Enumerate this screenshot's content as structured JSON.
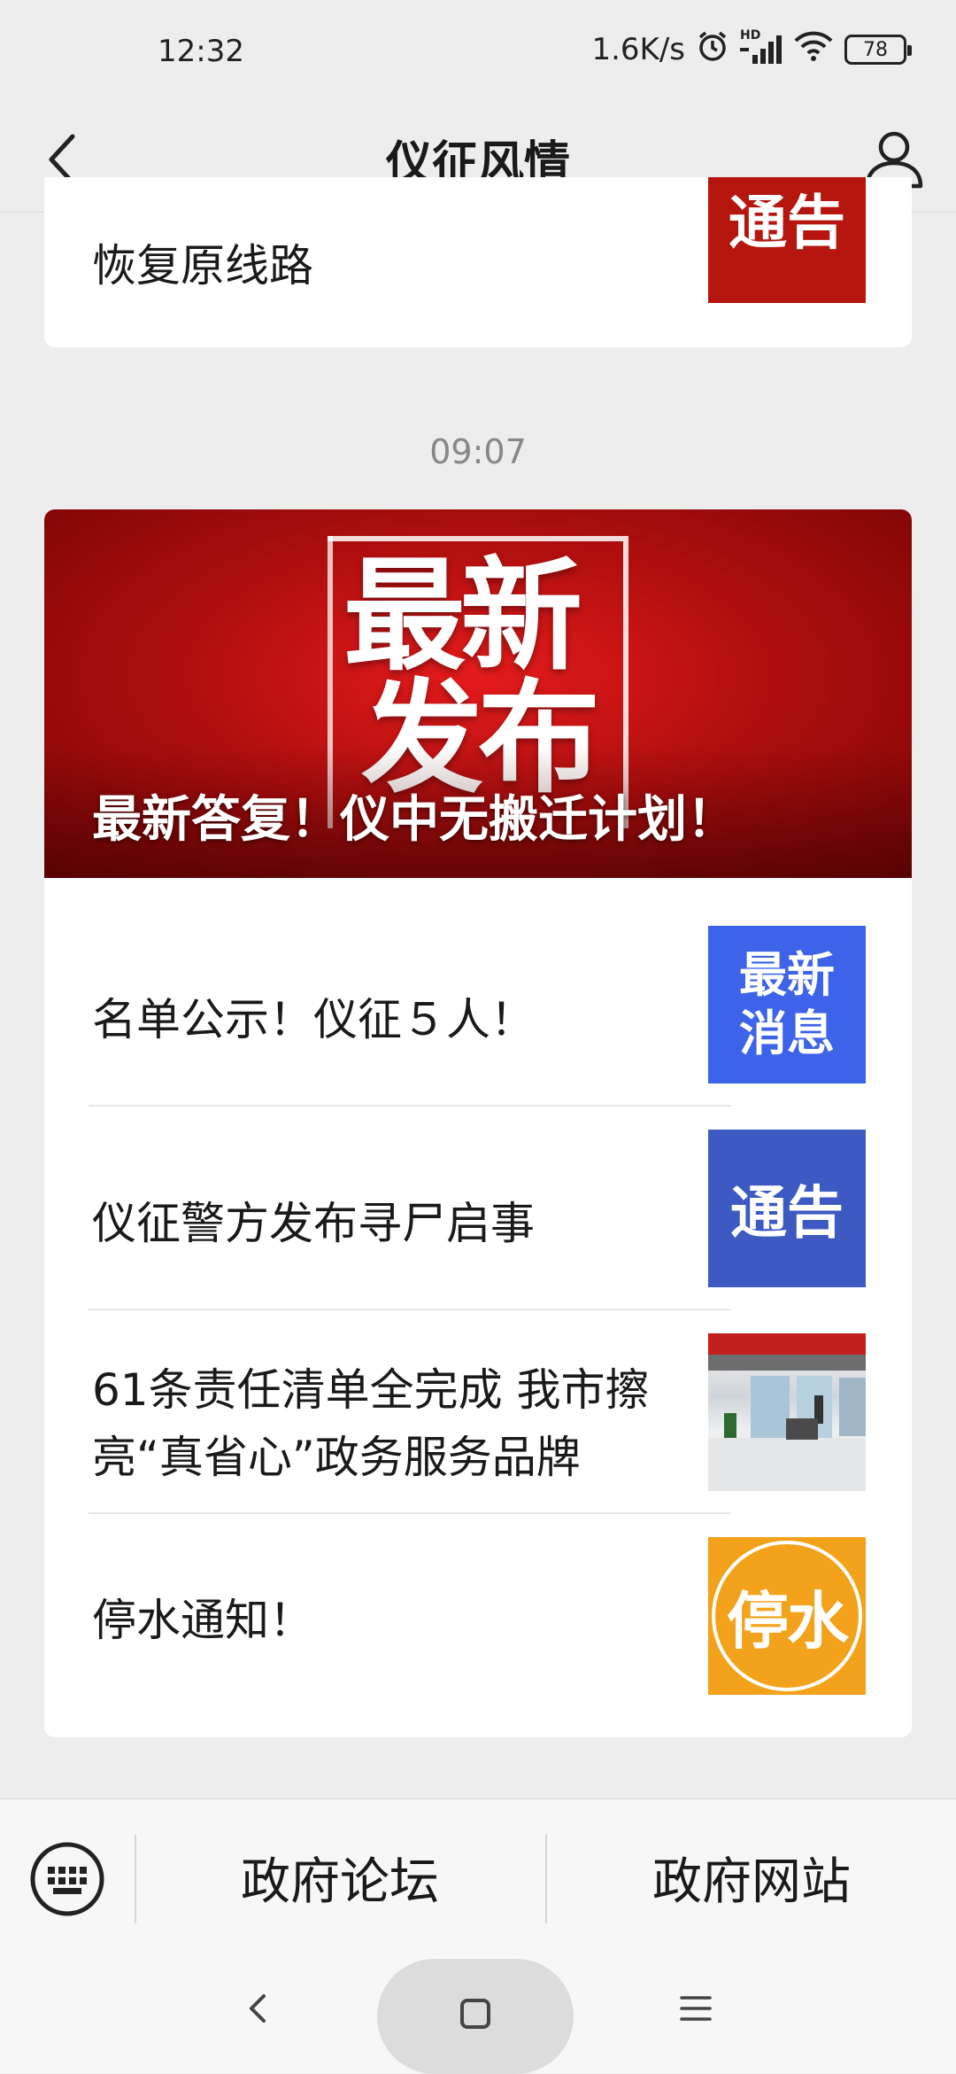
{
  "status_bar": {
    "time": "12:32",
    "net_speed": "1.6K/s",
    "signal_label": "HD",
    "battery": "78"
  },
  "header": {
    "title": "仪征风情",
    "back_icon": "chevron-left-icon",
    "profile_icon": "person-icon"
  },
  "top_card": {
    "title": "恢复原线路",
    "thumb_text": "通告"
  },
  "timestamp": "09:07",
  "hero": {
    "image_text_1": "最新",
    "image_text_2": "发布",
    "caption": "最新答复！仪中无搬迁计划！"
  },
  "articles": [
    {
      "title": "名单公示！仪征５人！",
      "thumb_text": "最新\n消息"
    },
    {
      "title": "仪征警方发布寻尸启事",
      "thumb_text": "通告"
    },
    {
      "title": "61条责任清单全完成 我市擦亮“真省心”政务服务品牌",
      "thumb_text": ""
    },
    {
      "title": "停水通知！",
      "thumb_text": "停水"
    }
  ],
  "bottom_menu": {
    "keyboard_icon": "keyboard-icon",
    "items": [
      "政府论坛",
      "政府网站"
    ]
  },
  "nav_bar": {
    "back_icon": "back-icon",
    "home_icon": "home-icon",
    "menu_icon": "menu-icon"
  }
}
